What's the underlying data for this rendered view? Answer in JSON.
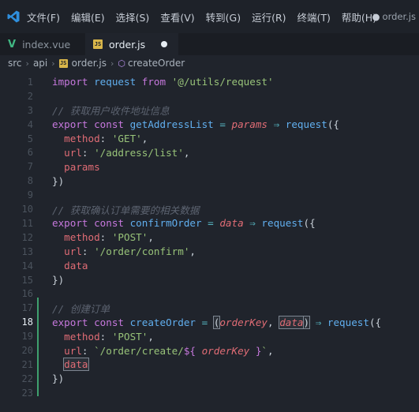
{
  "menu": {
    "items": [
      "文件(F)",
      "编辑(E)",
      "选择(S)",
      "查看(V)",
      "转到(G)",
      "运行(R)",
      "终端(T)",
      "帮助(H)"
    ],
    "window_title": "order.js"
  },
  "tabs": [
    {
      "label": "index.vue",
      "icon": "vue-icon",
      "active": false
    },
    {
      "label": "order.js",
      "icon": "js-icon",
      "active": true,
      "modified": true
    }
  ],
  "breadcrumb": {
    "parts": [
      "src",
      "api",
      "order.js",
      "createOrder"
    ],
    "js_badge": "JS"
  },
  "editor": {
    "current_line": 18,
    "lines": [
      {
        "n": "1",
        "tokens": [
          [
            "kw",
            "import "
          ],
          [
            "fn",
            "request "
          ],
          [
            "kw",
            "from "
          ],
          [
            "str",
            "'@/utils/request'"
          ]
        ]
      },
      {
        "n": "2",
        "tokens": []
      },
      {
        "n": "3",
        "tokens": [
          [
            "cm",
            "// 获取用户收件地址信息"
          ]
        ]
      },
      {
        "n": "4",
        "tokens": [
          [
            "kw",
            "export "
          ],
          [
            "kw",
            "const "
          ],
          [
            "fn",
            "getAddressList "
          ],
          [
            "op",
            "= "
          ],
          [
            "param",
            "params "
          ],
          [
            "op",
            "⇒ "
          ],
          [
            "fn",
            "request"
          ],
          [
            "plain",
            "({"
          ]
        ]
      },
      {
        "n": "5",
        "tokens": [
          [
            "plain",
            "  "
          ],
          [
            "prop",
            "method"
          ],
          [
            "plain",
            ": "
          ],
          [
            "str",
            "'GET'"
          ],
          [
            "plain",
            ","
          ]
        ]
      },
      {
        "n": "6",
        "tokens": [
          [
            "plain",
            "  "
          ],
          [
            "prop",
            "url"
          ],
          [
            "plain",
            ": "
          ],
          [
            "str",
            "'/address/list'"
          ],
          [
            "plain",
            ","
          ]
        ]
      },
      {
        "n": "7",
        "tokens": [
          [
            "plain",
            "  "
          ],
          [
            "prop",
            "params"
          ]
        ]
      },
      {
        "n": "8",
        "tokens": [
          [
            "plain",
            "})"
          ]
        ]
      },
      {
        "n": "9",
        "tokens": []
      },
      {
        "n": "10",
        "tokens": [
          [
            "cm",
            "// 获取确认订单需要的相关数据"
          ]
        ]
      },
      {
        "n": "11",
        "tokens": [
          [
            "kw",
            "export "
          ],
          [
            "kw",
            "const "
          ],
          [
            "fn",
            "confirmOrder "
          ],
          [
            "op",
            "= "
          ],
          [
            "param",
            "data "
          ],
          [
            "op",
            "⇒ "
          ],
          [
            "fn",
            "request"
          ],
          [
            "plain",
            "({"
          ]
        ]
      },
      {
        "n": "12",
        "tokens": [
          [
            "plain",
            "  "
          ],
          [
            "prop",
            "method"
          ],
          [
            "plain",
            ": "
          ],
          [
            "str",
            "'POST'"
          ],
          [
            "plain",
            ","
          ]
        ]
      },
      {
        "n": "13",
        "tokens": [
          [
            "plain",
            "  "
          ],
          [
            "prop",
            "url"
          ],
          [
            "plain",
            ": "
          ],
          [
            "str",
            "'/order/confirm'"
          ],
          [
            "plain",
            ","
          ]
        ]
      },
      {
        "n": "14",
        "tokens": [
          [
            "plain",
            "  "
          ],
          [
            "prop",
            "data"
          ]
        ]
      },
      {
        "n": "15",
        "tokens": [
          [
            "plain",
            "})"
          ]
        ]
      },
      {
        "n": "16",
        "tokens": []
      },
      {
        "n": "17",
        "tokens": [
          [
            "cm",
            "// 创建订单"
          ]
        ]
      },
      {
        "n": "18",
        "tokens": [
          [
            "kw",
            "export "
          ],
          [
            "kw",
            "const "
          ],
          [
            "fn",
            "createOrder "
          ],
          [
            "op",
            "= "
          ],
          [
            "hl",
            "("
          ],
          [
            "param",
            "orderKey"
          ],
          [
            "plain",
            ", "
          ],
          [
            "hlparam",
            "data"
          ],
          [
            "hl",
            ")"
          ],
          [
            "op",
            " ⇒ "
          ],
          [
            "fn",
            "request"
          ],
          [
            "plain",
            "({"
          ]
        ]
      },
      {
        "n": "19",
        "tokens": [
          [
            "plain",
            "  "
          ],
          [
            "prop",
            "method"
          ],
          [
            "plain",
            ": "
          ],
          [
            "str",
            "'POST'"
          ],
          [
            "plain",
            ","
          ]
        ]
      },
      {
        "n": "20",
        "tokens": [
          [
            "plain",
            "  "
          ],
          [
            "prop",
            "url"
          ],
          [
            "plain",
            ": "
          ],
          [
            "str",
            "`/order/create/"
          ],
          [
            "tmpl",
            "${ "
          ],
          [
            "param",
            "orderKey"
          ],
          [
            "tmpl",
            " }"
          ],
          [
            "str",
            "`"
          ],
          [
            "plain",
            ","
          ]
        ]
      },
      {
        "n": "21",
        "tokens": [
          [
            "plain",
            "  "
          ],
          [
            "hlprop",
            "data"
          ]
        ]
      },
      {
        "n": "22",
        "tokens": [
          [
            "plain",
            "})"
          ]
        ]
      },
      {
        "n": "23",
        "tokens": []
      }
    ]
  },
  "colors": {
    "keyword": "#c678dd",
    "function": "#61afef",
    "string": "#98c379",
    "comment": "#5c6370",
    "parameter": "#e06c75",
    "git_added": "#3fa06e",
    "vscode_blue": "#2f8fdd"
  }
}
